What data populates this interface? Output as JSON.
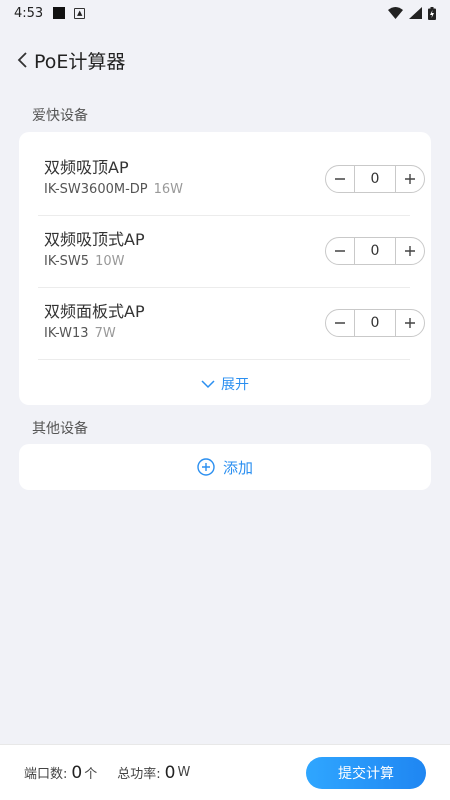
{
  "status_bar": {
    "time": "4:53"
  },
  "header": {
    "title": "PoE计算器"
  },
  "sections": {
    "ikuai": {
      "label": "爱快设备"
    },
    "other": {
      "label": "其他设备"
    }
  },
  "devices": [
    {
      "name": "双频吸顶AP",
      "model": "IK-SW3600M-DP",
      "watt": "16W",
      "count": "0"
    },
    {
      "name": "双频吸顶式AP",
      "model": "IK-SW5",
      "watt": "10W",
      "count": "0"
    },
    {
      "name": "双频面板式AP",
      "model": "IK-W13",
      "watt": "7W",
      "count": "0"
    }
  ],
  "expand": {
    "label": "展开"
  },
  "add": {
    "label": "添加"
  },
  "footer": {
    "ports_label": "端口数:",
    "ports_value": "0",
    "ports_unit": "个",
    "power_label": "总功率:",
    "power_value": "0",
    "power_unit": "W",
    "submit_label": "提交计算"
  },
  "colors": {
    "accent": "#2b8ff0",
    "background": "#f1f2f7"
  },
  "icons": [
    "back-chevron-icon",
    "minus-icon",
    "plus-icon",
    "chevron-down-icon",
    "add-circle-icon",
    "wifi-icon",
    "signal-icon",
    "battery-icon"
  ]
}
